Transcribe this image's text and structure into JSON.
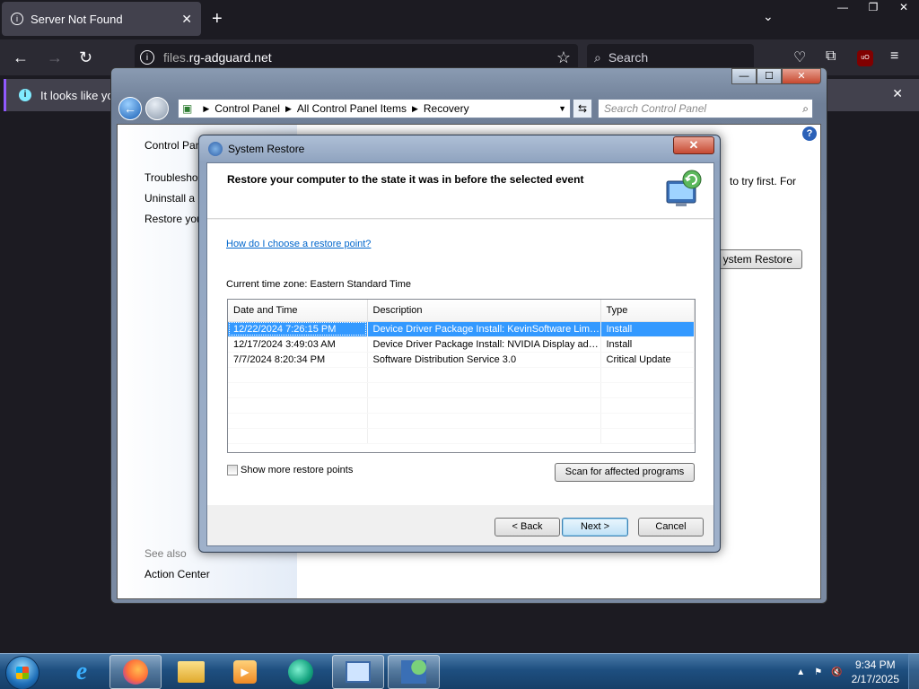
{
  "browser": {
    "tab_title": "Server Not Found",
    "tab_close": "✕",
    "new_tab": "+",
    "list_tabs": "⌄",
    "window_controls": [
      "—",
      "❐",
      "✕"
    ],
    "url_domain_grey": "files.",
    "url_domain_main": "rg-adguard.net",
    "search_placeholder": "Search",
    "ublock_label": "uO",
    "notification_text": "It looks like yo"
  },
  "control_panel": {
    "caption_buttons": [
      "—",
      "☐",
      "✕"
    ],
    "breadcrumb": [
      "Control Panel",
      "All Control Panel Items",
      "Recovery"
    ],
    "search_placeholder": "Search Control Panel",
    "left_links": {
      "home": "Control Pan",
      "troubleshoot": "Troubleshoo",
      "uninstall": "Uninstall a p",
      "restore": "Restore you"
    },
    "see_also": "See also",
    "action_center": "Action Center",
    "right_text": "to try first. For",
    "open_system_restore": "ystem Restore"
  },
  "system_restore": {
    "window_title": "System Restore",
    "heading": "Restore your computer to the state it was in before the selected event",
    "help_link": "How do I choose a restore point?",
    "timezone": "Current time zone: Eastern Standard Time",
    "columns": [
      "Date and Time",
      "Description",
      "Type"
    ],
    "rows": [
      {
        "date": "12/22/2024 7:26:15 PM",
        "description": "Device Driver Package Install: KevinSoftware Limited",
        "type": "Install",
        "selected": true
      },
      {
        "date": "12/17/2024 3:49:03 AM",
        "description": "Device Driver Package Install: NVIDIA Display adapter",
        "type": "Install",
        "selected": false
      },
      {
        "date": "7/7/2024 8:20:34 PM",
        "description": "Software Distribution Service 3.0",
        "type": "Critical Update",
        "selected": false
      }
    ],
    "show_more": "Show more restore points",
    "scan_button": "Scan for affected programs",
    "back_button": "< Back",
    "next_button": "Next >",
    "cancel_button": "Cancel"
  },
  "taskbar": {
    "time": "9:34 PM",
    "date": "2/17/2025",
    "items": [
      "start-orb",
      "internet-explorer",
      "firefox",
      "file-explorer",
      "media-player",
      "browser-app",
      "control-panel",
      "system-restore"
    ]
  }
}
